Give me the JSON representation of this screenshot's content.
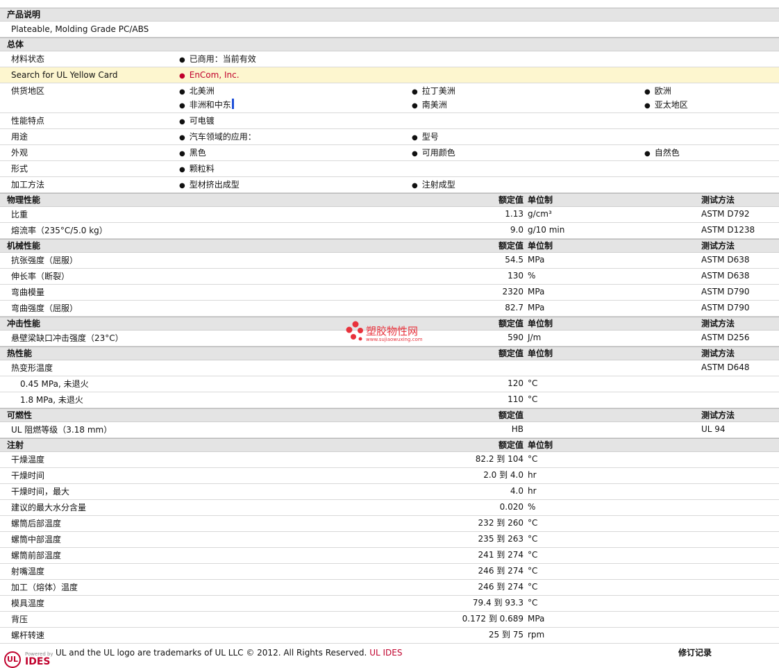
{
  "sections": [
    {
      "type": "header",
      "label": "产品说明"
    },
    {
      "type": "row",
      "label": "Plateable, Molding Grade PC/ABS"
    },
    {
      "type": "header",
      "label": "总体"
    },
    {
      "type": "row",
      "label": "材料状态",
      "items": [
        {
          "text": "已商用：当前有效",
          "col": 1
        }
      ]
    },
    {
      "type": "row",
      "label": "Search for UL Yellow Card",
      "yellow": true,
      "items": [
        {
          "text": "EnCom, Inc.",
          "col": 1,
          "red": true
        }
      ]
    },
    {
      "type": "row",
      "label": "供货地区",
      "tall": true,
      "items": [
        {
          "text": "北美洲",
          "col": 1,
          "line": 0
        },
        {
          "text": "拉丁美洲",
          "col": 2,
          "line": 0
        },
        {
          "text": "欧洲",
          "col": 3,
          "line": 0
        },
        {
          "text": "非洲和中东",
          "col": 1,
          "line": 1,
          "cursor": true
        },
        {
          "text": "南美洲",
          "col": 2,
          "line": 1
        },
        {
          "text": "亚太地区",
          "col": 3,
          "line": 1
        }
      ]
    },
    {
      "type": "row",
      "label": "性能特点",
      "items": [
        {
          "text": "可电镀",
          "col": 1
        }
      ]
    },
    {
      "type": "row",
      "label": "用途",
      "items": [
        {
          "text": "汽车领域的应用：",
          "col": 1
        },
        {
          "text": "型号",
          "col": 2
        }
      ]
    },
    {
      "type": "row",
      "label": "外观",
      "items": [
        {
          "text": "黑色",
          "col": 1
        },
        {
          "text": "可用颜色",
          "col": 2
        },
        {
          "text": "自然色",
          "col": 3
        }
      ]
    },
    {
      "type": "row",
      "label": "形式",
      "items": [
        {
          "text": "颗粒料",
          "col": 1
        }
      ]
    },
    {
      "type": "row",
      "label": "加工方法",
      "items": [
        {
          "text": "型材挤出成型",
          "col": 1
        },
        {
          "text": "注射成型",
          "col": 2
        }
      ]
    },
    {
      "type": "header",
      "label": "物理性能",
      "nominal": "额定值",
      "unit": "单位制",
      "method": "测试方法"
    },
    {
      "type": "row",
      "label": "比重",
      "nominal": "1.13",
      "unit": "g/cm³",
      "method": "ASTM D792"
    },
    {
      "type": "row",
      "label": "熔流率（235°C/5.0 kg）",
      "nominal": "9.0",
      "unit": "g/10 min",
      "method": "ASTM D1238"
    },
    {
      "type": "header",
      "label": "机械性能",
      "nominal": "额定值",
      "unit": "单位制",
      "method": "测试方法"
    },
    {
      "type": "row",
      "label": "抗张强度（屈服）",
      "nominal": "54.5",
      "unit": "MPa",
      "method": "ASTM D638"
    },
    {
      "type": "row",
      "label": "伸长率（断裂）",
      "nominal": "130",
      "unit": "%",
      "method": "ASTM D638"
    },
    {
      "type": "row",
      "label": "弯曲模量",
      "nominal": "2320",
      "unit": "MPa",
      "method": "ASTM D790"
    },
    {
      "type": "row",
      "label": "弯曲强度（屈服）",
      "nominal": "82.7",
      "unit": "MPa",
      "method": "ASTM D790"
    },
    {
      "type": "header",
      "label": "冲击性能",
      "nominal": "额定值",
      "unit": "单位制",
      "method": "测试方法"
    },
    {
      "type": "row",
      "label": "悬壁梁缺口冲击强度（23°C）",
      "nominal": "590",
      "unit": "J/m",
      "method": "ASTM D256"
    },
    {
      "type": "header",
      "label": "热性能",
      "nominal": "额定值",
      "unit": "单位制",
      "method": "测试方法"
    },
    {
      "type": "row",
      "label": "热变形温度",
      "method": "ASTM D648"
    },
    {
      "type": "row",
      "label": "0.45 MPa, 未退火",
      "sub": true,
      "nominal": "120",
      "unit": "°C"
    },
    {
      "type": "row",
      "label": "1.8 MPa, 未退火",
      "sub": true,
      "nominal": "110",
      "unit": "°C"
    },
    {
      "type": "header",
      "label": "可燃性",
      "nominal": "额定值",
      "method": "测试方法"
    },
    {
      "type": "row",
      "label": "UL 阻燃等级（3.18 mm）",
      "nominal": "HB",
      "method": "UL 94"
    },
    {
      "type": "header",
      "label": "注射",
      "nominal": "额定值",
      "unit": "单位制"
    },
    {
      "type": "row",
      "label": "干燥温度",
      "nominal": "82.2 到  104",
      "unit": "°C"
    },
    {
      "type": "row",
      "label": "干燥时间",
      "nominal": "2.0 到  4.0",
      "unit": "hr"
    },
    {
      "type": "row",
      "label": "干燥时间，最大",
      "nominal": "4.0",
      "unit": "hr"
    },
    {
      "type": "row",
      "label": "建议的最大水分含量",
      "nominal": "0.020",
      "unit": "%"
    },
    {
      "type": "row",
      "label": "螺筒后部温度",
      "nominal": "232 到  260",
      "unit": "°C"
    },
    {
      "type": "row",
      "label": "螺筒中部温度",
      "nominal": "235 到  263",
      "unit": "°C"
    },
    {
      "type": "row",
      "label": "螺筒前部温度",
      "nominal": "241 到  274",
      "unit": "°C"
    },
    {
      "type": "row",
      "label": "射嘴温度",
      "nominal": "246 到  274",
      "unit": "°C"
    },
    {
      "type": "row",
      "label": "加工（熔体）温度",
      "nominal": "246 到  274",
      "unit": "°C"
    },
    {
      "type": "row",
      "label": "模具温度",
      "nominal": "79.4 到  93.3",
      "unit": "°C"
    },
    {
      "type": "row",
      "label": "背压",
      "nominal": "0.172 到  0.689",
      "unit": "MPa"
    },
    {
      "type": "row",
      "label": "螺杆转速",
      "nominal": "25 到  75",
      "unit": "rpm"
    }
  ],
  "watermark": {
    "text": "塑胶物性网",
    "url": "www.sujiaowuxing.com"
  },
  "footer": {
    "ul_badge": "UL",
    "powered_by": "Powered by",
    "ides": "IDES",
    "trademark": "UL and the UL logo are trademarks of UL LLC © 2012. All Rights Reserved.",
    "ul_ides_link": "UL IDES",
    "revision": "修订记录"
  },
  "colors": {
    "header_bg": "#e4e4e4",
    "yellow_row": "#fdf6cf",
    "red": "#c0002c",
    "watermark": "#e8323c"
  }
}
